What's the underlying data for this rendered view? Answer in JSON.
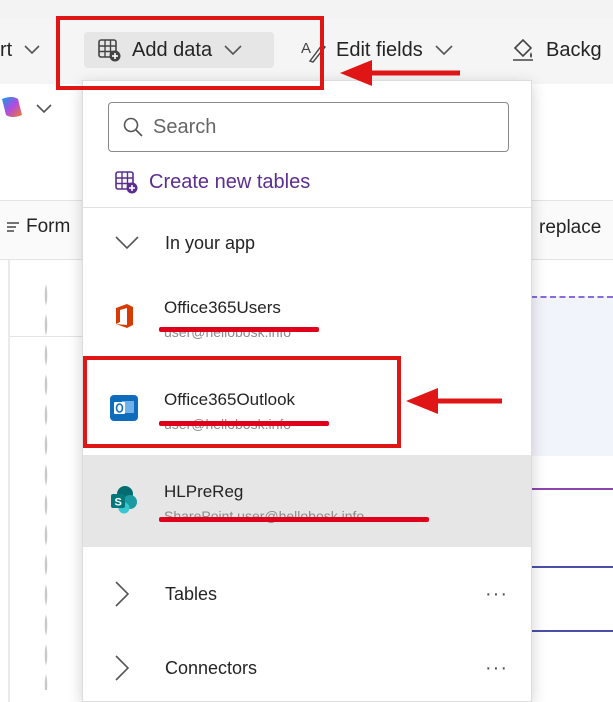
{
  "toolbar": {
    "partial_left_label": "rt",
    "add_data_label": "Add data",
    "edit_fields_label": "Edit fields",
    "background_label": "Backg"
  },
  "left_pane": {
    "formula_label": "Form"
  },
  "right_pane": {
    "replace_label": "replace"
  },
  "panel": {
    "search": {
      "placeholder": "Search",
      "value": ""
    },
    "create_new_tables_label": "Create new tables",
    "in_your_app": {
      "label": "In your app",
      "connections": [
        {
          "name": "Office365Users",
          "sub": "user@hellobosk.info",
          "icon": "office-icon"
        },
        {
          "name": "Office365Outlook",
          "sub": "user@hellobosk.info",
          "icon": "outlook-icon"
        },
        {
          "name": "HLPreReg",
          "sub": "SharePoint user@hellobosk.info",
          "icon": "sharepoint-icon",
          "selected": true
        }
      ]
    },
    "tables_label": "Tables",
    "connectors_label": "Connectors",
    "more_label": "···"
  },
  "colors": {
    "accent_purple": "#5c2d91",
    "annotation_red": "#e01515",
    "selected_row": "#e6e6e6"
  }
}
